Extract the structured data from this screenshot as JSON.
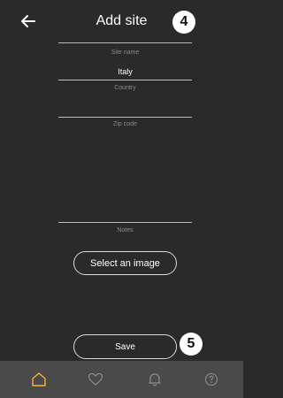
{
  "header": {
    "title": "Add site",
    "step_badge": "4"
  },
  "form": {
    "site_name": {
      "label": "Site name",
      "value": "Italy"
    },
    "country": {
      "label": "Country",
      "value": ""
    },
    "zip_code": {
      "label": "Zip code",
      "value": ""
    },
    "notes": {
      "label": "Notes",
      "value": ""
    }
  },
  "actions": {
    "select_image_label": "Select an image",
    "save_label": "Save",
    "save_step_badge": "5"
  },
  "bottom_nav": {
    "items": [
      {
        "icon": "home-icon",
        "active": true
      },
      {
        "icon": "heart-icon",
        "active": false
      },
      {
        "icon": "bell-icon",
        "active": false
      },
      {
        "icon": "help-icon",
        "active": false
      }
    ]
  },
  "colors": {
    "background": "#2a2a2a",
    "nav_background": "#4a4a4a",
    "accent": "#f2b632",
    "nav_icon": "#8f8f8f"
  }
}
